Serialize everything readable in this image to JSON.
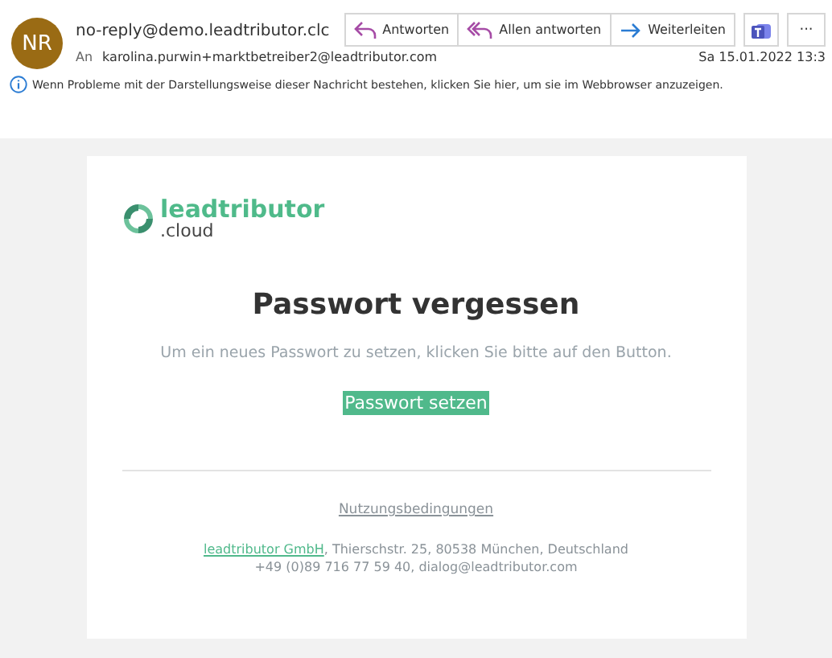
{
  "header": {
    "avatar": "NR",
    "sender": "no-reply@demo.leadtributor.clc",
    "to_label": "An",
    "recipient": "karolina.purwin+marktbetreiber2@leadtributor.com",
    "date": "Sa 15.01.2022 13:3",
    "actions": [
      {
        "kind": "reply",
        "label": "Antworten"
      },
      {
        "kind": "reply_all",
        "label": "Allen antworten"
      },
      {
        "kind": "forward",
        "label": "Weiterleiten"
      },
      {
        "kind": "teams"
      },
      {
        "kind": "more",
        "label": "···"
      }
    ],
    "info": "Wenn Probleme mit der Darstellungsweise dieser Nachricht bestehen, klicken Sie hier, um sie im Webbrowser anzuzeigen."
  },
  "message": {
    "logo": {
      "name": "leadtributor",
      "suffix": ".cloud"
    },
    "title": "Passwort vergessen",
    "text": "Um ein neues Passwort zu setzen, klicken Sie bitte auf den Button.",
    "button": "Passwort setzen",
    "footer": {
      "terms_link": "Nutzungsbedingungen",
      "company_link": "leadtributor GmbH",
      "address": ", Thierschstr. 25, 80538 München, Deutschland",
      "contact": "+49 (0)89 716 77 59 40, dialog@leadtributor.com"
    }
  }
}
